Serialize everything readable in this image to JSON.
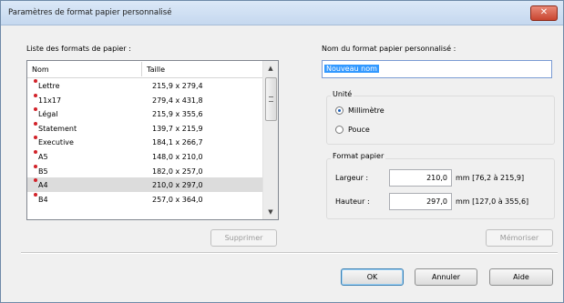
{
  "window": {
    "title": "Paramètres de format papier personnalisé",
    "close_glyph": "✕"
  },
  "list": {
    "label": "Liste des formats de papier :",
    "columns": [
      "Nom",
      "Taille"
    ],
    "rows": [
      {
        "name": "Lettre",
        "size": "215,9 x 279,4"
      },
      {
        "name": "11x17",
        "size": "279,4 x 431,8"
      },
      {
        "name": "Légal",
        "size": "215,9 x 355,6"
      },
      {
        "name": "Statement",
        "size": "139,7 x 215,9"
      },
      {
        "name": "Executive",
        "size": "184,1 x 266,7"
      },
      {
        "name": "A5",
        "size": "148,0 x 210,0"
      },
      {
        "name": "B5",
        "size": "182,0 x 257,0"
      },
      {
        "name": "A4",
        "size": "210,0 x 297,0"
      },
      {
        "name": "B4",
        "size": "257,0 x 364,0"
      }
    ],
    "selected_row": "A4",
    "delete_label": "Supprimer"
  },
  "custom": {
    "name_label": "Nom du format papier personnalisé :",
    "name_value": "Nouveau nom",
    "unit_group_label": "Unité",
    "unit_options": [
      "Millimètre",
      "Pouce"
    ],
    "selected_unit": "Millimètre",
    "paper_group_label": "Format papier",
    "width_label": "Largeur :",
    "width_value": "210,0",
    "width_range": "mm [76,2 à 215,9]",
    "height_label": "Hauteur :",
    "height_value": "297,0",
    "height_range": "mm [127,0 à 355,6]",
    "save_label": "Mémoriser"
  },
  "footer": {
    "ok_label": "OK",
    "cancel_label": "Annuler",
    "help_label": "Aide"
  },
  "colors": {
    "accent": "#3399ff",
    "mark": "#d2232a",
    "close": "#c84530"
  }
}
